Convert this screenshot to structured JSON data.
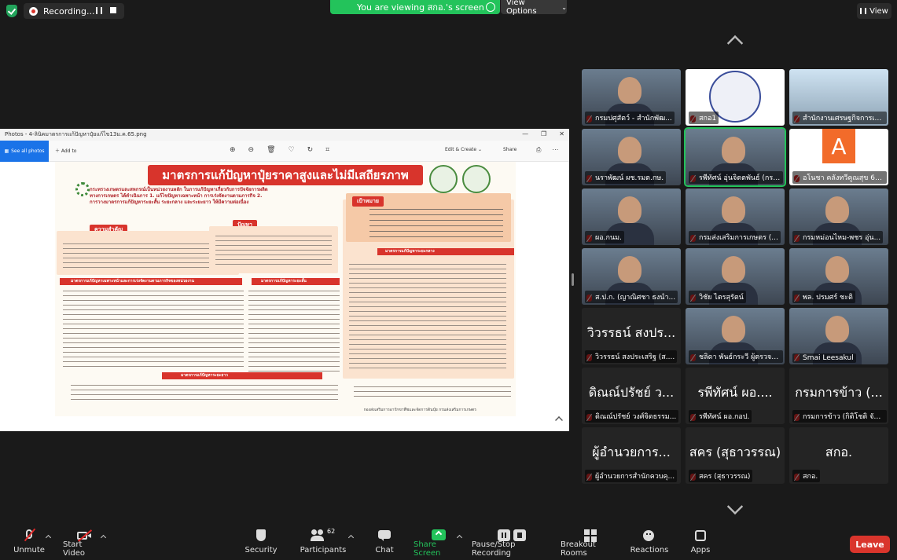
{
  "recording": {
    "label": "Recording..."
  },
  "banner": {
    "viewing": "You are viewing สกอ.'s screen",
    "view_options": "View Options"
  },
  "view_button": {
    "label": "View"
  },
  "photos": {
    "title": "Photos - 4-ลินิคมาตรการแก้ปัญหาปุ๋ยแก้ไข13ม.ค.65.png",
    "see_all": "See all photos",
    "add_to": "Add to",
    "edit_create": "Edit & Create",
    "share": "Share",
    "poster": {
      "title": "มาตรการแก้ปัญหาปุ๋ยราคาสูงและไม่มีเสถียรภาพ",
      "intro": "กระทรวงเกษตรและสหกรณ์เป็นหน่วยงานหลัก ในการแก้ปัญหาเกี่ยวกับการปัจจัยการผลิตทางการเกษตร ได้ดำเนินการ 1. แก้ไขปัญหาเฉพาะหน้า การเร่งจัดงานตามภารกิจ 2. การวางมาตรการแก้ปัญหาระยะสั้น ระยะกลาง และระยะยาว ให้มีความต่อเนื่อง",
      "importance": "ความสำคัญ",
      "problem": "ปัญหา",
      "goal": "เป้าหมาย",
      "measure1": "มาตรการแก้ปัญหาเฉพาะหน้าและการเร่งจัดงานตามภารกิจของหน่วยงาน",
      "measure2": "มาตรการแก้ปัญหาระยะสั้น",
      "measure3": "มาตรการแก้ปัญหาระยะกลาง",
      "measure4": "มาตรการแก้ปัญหาระยะยาว",
      "footer": "กองส่งเสริมการอารักขาพืชและจัดการดินปุ๋ย กรมส่งเสริมการเกษตร"
    }
  },
  "participants": [
    {
      "name": "กรมปศุสัตว์ - สำนักพัฒ...",
      "kind": "video"
    },
    {
      "name": "สกอ1",
      "kind": "seal"
    },
    {
      "name": "สำนักงานเศรษฐกิจการเกษตร",
      "kind": "building"
    },
    {
      "name": "นราพัฒน์ ผช.รมต.กษ.",
      "kind": "video"
    },
    {
      "name": "รพีทัศน์ อุ่นจิตตพันธ์ (กรมส่...",
      "kind": "video",
      "active": true
    },
    {
      "name": "อโนชา คลังทวีคูณสุข 69...",
      "kind": "avatar",
      "letter": "A"
    },
    {
      "name": "ผอ.กนม.",
      "kind": "video"
    },
    {
      "name": "กรมส่งเสริมการเกษตร (...",
      "kind": "video"
    },
    {
      "name": "กรมหม่อนไหม-พชร อุ่น...",
      "kind": "video"
    },
    {
      "name": "ส.ป.ก. (ญาณิศชา ธงนำ...",
      "kind": "video"
    },
    {
      "name": "วิชัย ไตรสุรัตน์",
      "kind": "video"
    },
    {
      "name": "พล. ปรมศร์ ชะติ",
      "kind": "video"
    },
    {
      "name": "วิวรรธน์ สงประเสริฐ (ส....",
      "kind": "text",
      "big": "วิวรรธน์ สงปร..."
    },
    {
      "name": "ชลิดา พันธ์กระวี ผู้ตรวจร...",
      "kind": "video"
    },
    {
      "name": "Smai Leesakul",
      "kind": "video"
    },
    {
      "name": "ดิณณ์ปรัชย์ วงศ์จิตธรรม...",
      "kind": "text",
      "big": "ดิณณ์ปรัชย์ ว..."
    },
    {
      "name": "รพีทัศน์ ผอ.กอป.",
      "kind": "text",
      "big": "รพีทัศน์ ผอ...."
    },
    {
      "name": "กรมการข้าว (กิติโชติ จัน...",
      "kind": "text",
      "big": "กรมการข้าว (..."
    },
    {
      "name": "ผู้อำนวยการสำนักควบคุ...",
      "kind": "text",
      "big": "ผู้อำนวยการ..."
    },
    {
      "name": "สคร (สุธาวรรณ)",
      "kind": "text",
      "big": "สคร (สุธาวรรณ)"
    },
    {
      "name": "สกอ.",
      "kind": "text",
      "big": "สกอ."
    }
  ],
  "toolbar": {
    "unmute": "Unmute",
    "start_video": "Start Video",
    "security": "Security",
    "participants": "Participants",
    "participants_count": "62",
    "chat": "Chat",
    "share_screen": "Share Screen",
    "pause_recording": "Pause/Stop Recording",
    "breakout": "Breakout Rooms",
    "reactions": "Reactions",
    "apps": "Apps",
    "leave": "Leave"
  },
  "colors": {
    "accent_green": "#23c35b",
    "leave_red": "#d9352c",
    "poster_red": "#d8342c"
  }
}
